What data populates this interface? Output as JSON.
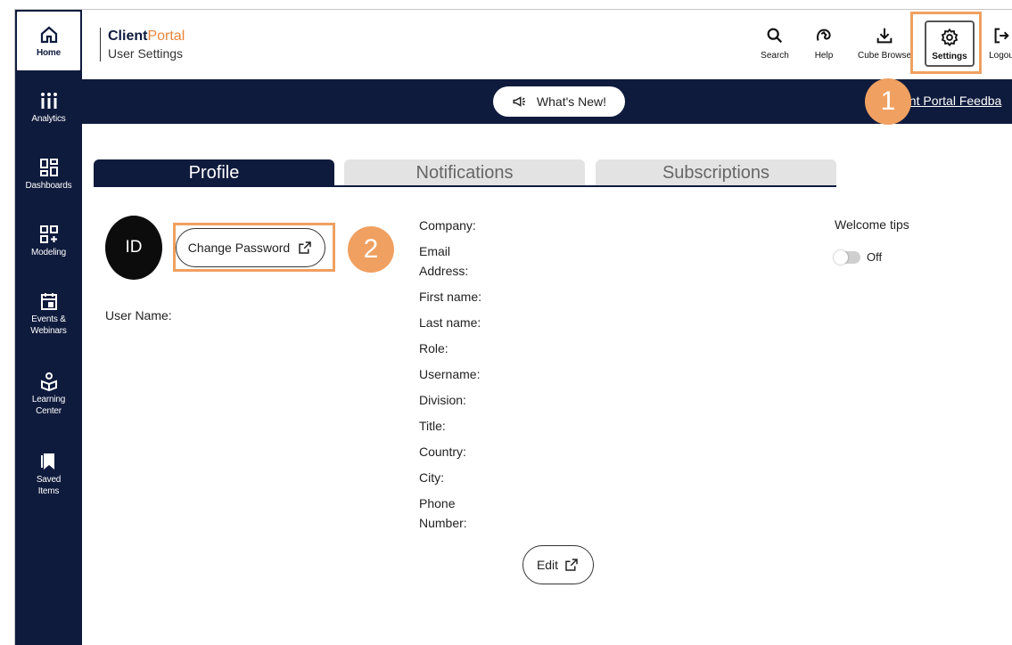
{
  "sidebar": {
    "items": [
      {
        "label": "Home",
        "icon": "home-icon"
      },
      {
        "label": "Analytics",
        "icon": "analytics-icon"
      },
      {
        "label": "Dashboards",
        "icon": "dashboards-icon"
      },
      {
        "label": "Modeling",
        "icon": "modeling-icon"
      },
      {
        "label": "Events &",
        "label2": "Webinars",
        "icon": "calendar-icon"
      },
      {
        "label": "Learning",
        "label2": "Center",
        "icon": "learning-icon"
      },
      {
        "label": "Saved",
        "label2": "Items",
        "icon": "bookmark-icon"
      }
    ]
  },
  "header": {
    "brand_bold": "Client",
    "brand_light": "Portal",
    "subtitle": "User Settings",
    "actions": [
      {
        "label": "Search",
        "icon": "search-icon"
      },
      {
        "label": "Help",
        "icon": "help-icon"
      },
      {
        "label": "Cube Browse",
        "icon": "download-icon"
      },
      {
        "label": "Settings",
        "icon": "gear-icon"
      },
      {
        "label": "Logou",
        "icon": "logout-icon"
      }
    ]
  },
  "banner": {
    "whats_new": "What's New!",
    "feedback": "ent Portal Feedba"
  },
  "markers": [
    "1",
    "2"
  ],
  "tabs": [
    {
      "label": "Profile",
      "active": true
    },
    {
      "label": "Notifications",
      "active": false
    },
    {
      "label": "Subscriptions",
      "active": false
    }
  ],
  "profile": {
    "initials": "ID",
    "change_password": "Change Password",
    "user_name_label": "User Name:",
    "fields": [
      {
        "label": "Company:"
      },
      {
        "label": "Email",
        "label2": "Address:"
      },
      {
        "label": "First name:"
      },
      {
        "label": "Last name:"
      },
      {
        "label": "Role:"
      },
      {
        "label": "Username:"
      },
      {
        "label": "Division:"
      },
      {
        "label": "Title:"
      },
      {
        "label": "Country:"
      },
      {
        "label": "City:"
      },
      {
        "label": "Phone",
        "label2": "Number:"
      }
    ],
    "edit": "Edit",
    "welcome_tips": "Welcome tips",
    "toggle_state": "Off"
  },
  "colors": {
    "navy": "#0f1b3d",
    "accent": "#f0a060",
    "brand_orange": "#e8843a"
  }
}
